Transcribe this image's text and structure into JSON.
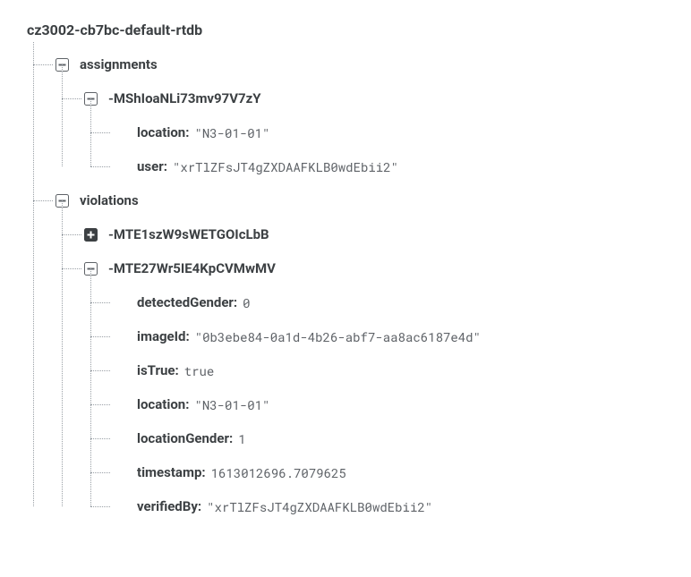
{
  "root": "cz3002-cb7bc-default-rtdb",
  "nodes": {
    "assignments": {
      "label": "assignments",
      "child1": {
        "label": "-MShIoaNLi73mv97V7zY",
        "location": {
          "key": "location:",
          "val": "\"N3-01-01\""
        },
        "user": {
          "key": "user:",
          "val": "\"xrTlZFsJT4gZXDAAFKLB0wdEbii2\""
        }
      }
    },
    "violations": {
      "label": "violations",
      "child1": {
        "label": "-MTE1szW9sWETGOIcLbB"
      },
      "child2": {
        "label": "-MTE27Wr5IE4KpCVMwMV",
        "detectedGender": {
          "key": "detectedGender:",
          "val": "0"
        },
        "imageId": {
          "key": "imageId:",
          "val": "\"0b3ebe84-0a1d-4b26-abf7-aa8ac6187e4d\""
        },
        "isTrue": {
          "key": "isTrue:",
          "val": "true"
        },
        "location": {
          "key": "location:",
          "val": "\"N3-01-01\""
        },
        "locationGender": {
          "key": "locationGender:",
          "val": "1"
        },
        "timestamp": {
          "key": "timestamp:",
          "val": "1613012696.7079625"
        },
        "verifiedBy": {
          "key": "verifiedBy:",
          "val": "\"xrTlZFsJT4gZXDAAFKLB0wdEbii2\""
        }
      }
    }
  }
}
